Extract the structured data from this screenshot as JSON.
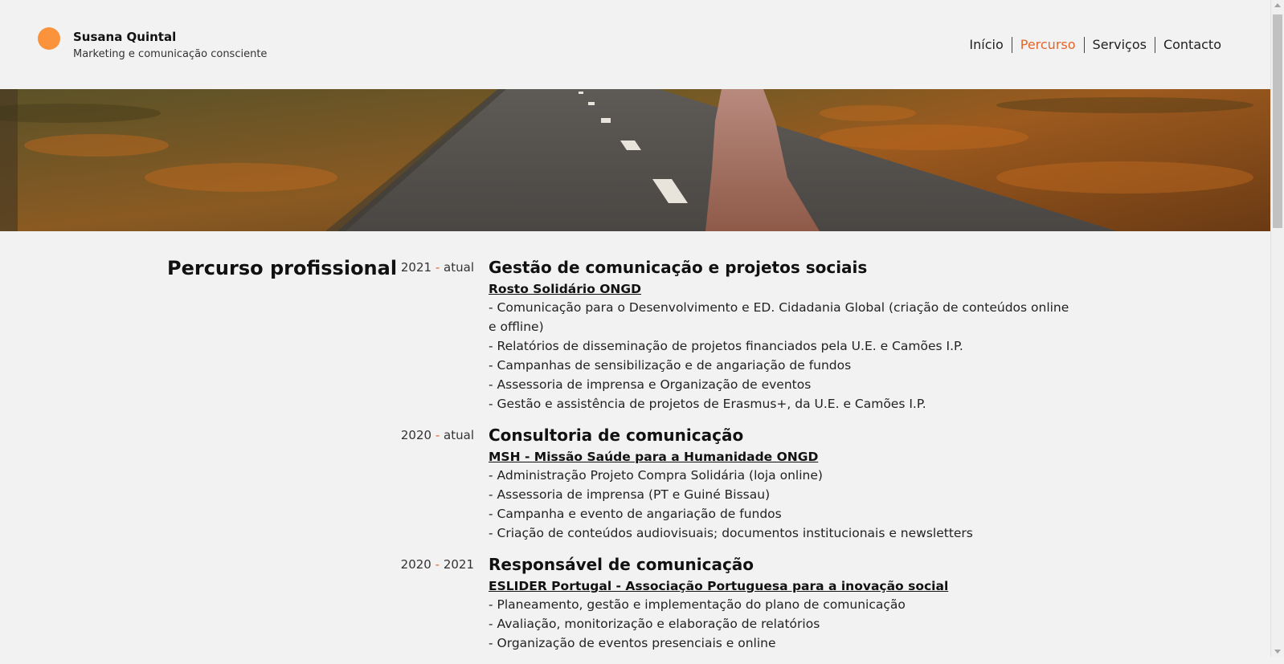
{
  "brand": {
    "name": "Susana Quintal",
    "tagline": "Marketing e comunicação consciente",
    "accent": "#fb923c"
  },
  "nav": {
    "items": [
      {
        "label": "Início",
        "active": false
      },
      {
        "label": "Percurso",
        "active": true
      },
      {
        "label": "Serviços",
        "active": false
      },
      {
        "label": "Contacto",
        "active": false
      }
    ],
    "active_color": "#e0662b"
  },
  "hero": {
    "description_icon": "road-landscape-image"
  },
  "section": {
    "title": "Percurso profissional"
  },
  "entries": [
    {
      "start": "2021",
      "end": "atual",
      "title": "Gestão de comunicação e projetos sociais",
      "org": "Rosto Solidário ONGD",
      "duties": [
        "- Comunicação para o Desenvolvimento e ED. Cidadania Global (criação de conteúdos online e offline)",
        "- Relatórios de disseminação de projetos financiados pela U.E. e Camões I.P.",
        "- Campanhas de sensibilização e de angariação de fundos",
        "- Assessoria de imprensa e Organização de eventos",
        "- Gestão e assistência de projetos de Erasmus+, da U.E. e Camões I.P."
      ]
    },
    {
      "start": "2020",
      "end": "atual",
      "title": "Consultoria de comunicação",
      "org": "MSH - Missão Saúde para a Humanidade ONGD",
      "duties": [
        "- Administração Projeto Compra Solidária (loja online)",
        "- Assessoria de imprensa (PT e Guiné Bissau)",
        "- Campanha e evento de angariação de fundos",
        "- Criação de conteúdos audiovisuais; documentos institucionais e newsletters"
      ]
    },
    {
      "start": "2020",
      "end": "2021",
      "title": "Responsável de comunicação",
      "org": "ESLIDER Portugal - Associação Portuguesa para a inovação social",
      "duties": [
        "- Planeamento, gestão e implementação do plano de comunicação",
        "- Avaliação, monitorização e elaboração de relatórios",
        "- Organização de eventos presenciais e online"
      ]
    }
  ]
}
